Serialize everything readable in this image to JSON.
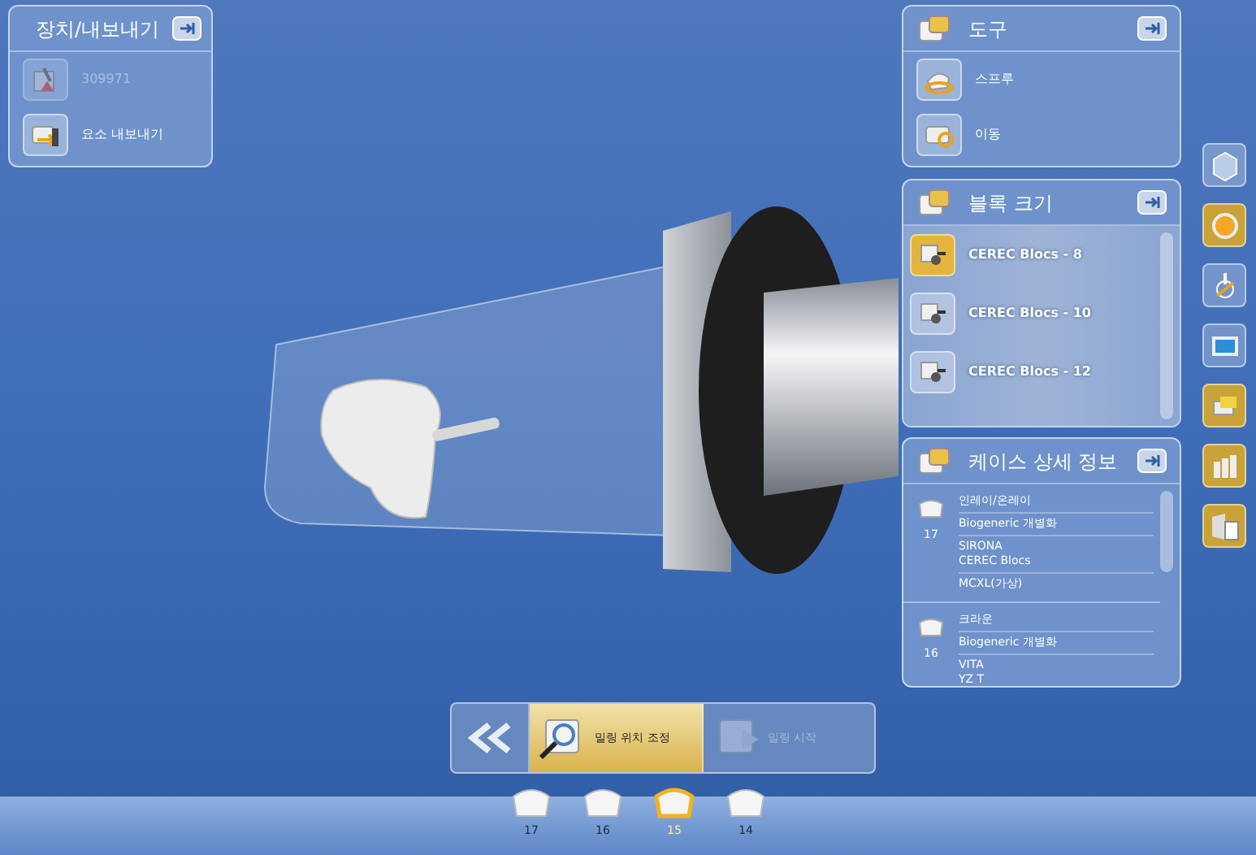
{
  "device_export": {
    "title": "장치/내보내기",
    "items": [
      {
        "label": "309971",
        "disabled": true
      },
      {
        "label": "요소 내보내기",
        "disabled": false
      }
    ]
  },
  "tools": {
    "title": "도구",
    "items": [
      {
        "label": "스프루"
      },
      {
        "label": "이동"
      }
    ]
  },
  "block_size": {
    "title": "블록 크기",
    "items": [
      {
        "label": "CEREC Blocs - 8",
        "selected": true
      },
      {
        "label": "CEREC Blocs - 10",
        "selected": false
      },
      {
        "label": "CEREC Blocs - 12",
        "selected": false
      }
    ]
  },
  "case_details": {
    "title": "케이스 상세 정보",
    "cases": [
      {
        "tooth": "17",
        "rows": [
          [
            "인레이/온레이"
          ],
          [
            "Biogeneric 개별화"
          ],
          [
            "SIRONA",
            "CEREC Blocs"
          ],
          [
            "MCXL(가상)"
          ]
        ]
      },
      {
        "tooth": "16",
        "rows": [
          [
            "크라운"
          ],
          [
            "Biogeneric 개별화"
          ],
          [
            "VITA",
            "YZ T"
          ]
        ]
      }
    ]
  },
  "side_toolbar": [
    {
      "active": false
    },
    {
      "active": true
    },
    {
      "active": false
    },
    {
      "active": false
    },
    {
      "active": true
    },
    {
      "active": true
    },
    {
      "active": true
    }
  ],
  "workflow": {
    "steps": [
      {
        "label": "밀링 위치 조정",
        "selected": true,
        "disabled": false
      },
      {
        "label": "밀링 시작",
        "selected": false,
        "disabled": true
      }
    ]
  },
  "teeth": [
    {
      "number": "17",
      "selected": false
    },
    {
      "number": "16",
      "selected": false
    },
    {
      "number": "15",
      "selected": true
    },
    {
      "number": "14",
      "selected": false
    }
  ]
}
